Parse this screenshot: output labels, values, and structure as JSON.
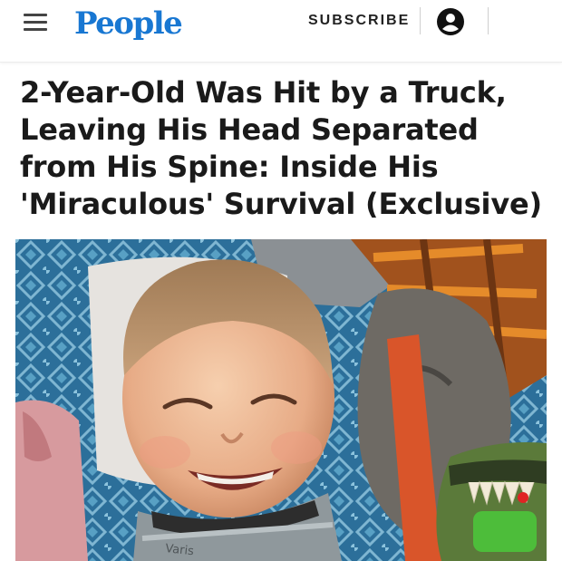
{
  "header": {
    "logo": "People",
    "subscribe_label": "SUBSCRIBE",
    "menu_icon": "hamburger-menu-icon",
    "account_icon": "user-account-icon",
    "brand_color": "#1877d2"
  },
  "article": {
    "headline": "2-Year-Old Was Hit by a Truck, Leaving His Head Separated from His Spine: Inside His 'Miraculous' Survival (Exclusive)",
    "image": {
      "subject": "smiling toddler wearing neck brace lying on bed with stuffed toys",
      "brace_text": "Varis"
    }
  }
}
